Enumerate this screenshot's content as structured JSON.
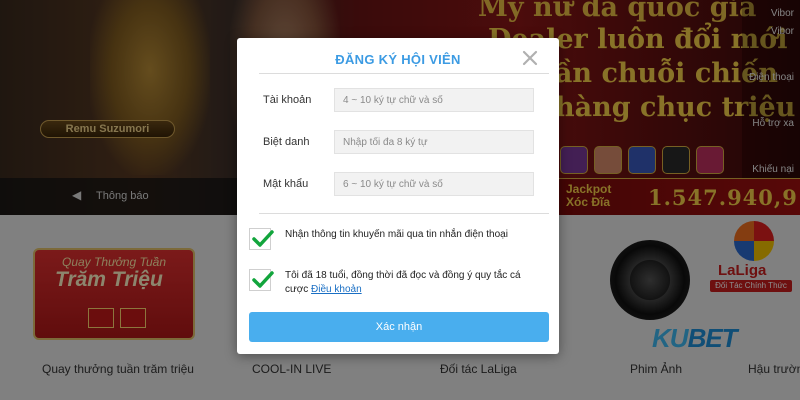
{
  "background": {
    "hero": {
      "badge": "Remu Suzumori",
      "headline_lines": [
        "My nữ đa quốc gia",
        "Dealer luôn đổi mới",
        "Phần chuỗi chiến",
        "hàng chục triệu"
      ],
      "notice_label": "Thông báo"
    },
    "side_menu": [
      "Vibor",
      "Vibor",
      "Điện thoại",
      "Hỗ trợ xa",
      "Khiếu nại"
    ],
    "jackpot": {
      "label_line1": "Jackpot",
      "label_line2": "Xóc Đĩa",
      "value": "1.547.940,9"
    },
    "promo": {
      "line1": "Quay Thưởng Tuần",
      "line2": "Trăm Triệu"
    },
    "laliga": {
      "name": "LaLiga",
      "tagline": "Đối Tác Chính Thức"
    },
    "brand": {
      "logo_part1": "KU",
      "logo_part2": "BET"
    },
    "categories": [
      "Quay thưởng tuần trăm triệu",
      "COOL-IN LIVE",
      "Đối tác LaLiga",
      "Phim Ảnh",
      "Hậu trườn"
    ],
    "colors": {
      "gold": "#f8d24a",
      "red": "#a01010"
    }
  },
  "modal": {
    "title": "ĐĂNG KÝ HỘI VIÊN",
    "close_icon": "close-icon",
    "fields": [
      {
        "label": "Tài khoản",
        "placeholder": "4 ~ 10 ký tự chữ và số",
        "value": ""
      },
      {
        "label": "Biệt danh",
        "placeholder": "Nhập tối đa 8 ký tự",
        "value": ""
      },
      {
        "label": "Mật khẩu",
        "placeholder": "6 ~ 10 ký tự chữ và số",
        "value": ""
      }
    ],
    "checkboxes": [
      {
        "text": "Nhận thông tin khuyến mãi qua tin nhắn điện thoại",
        "checked": true
      },
      {
        "text": "Tôi đã 18 tuổi, đồng thời đã đọc và đồng ý quy tắc cá cược",
        "link": "Điều khoản",
        "checked": true
      }
    ],
    "submit_label": "Xác nhận",
    "colors": {
      "title": "#3c9be3",
      "check": "#12a53c",
      "button": "#49aeee"
    }
  }
}
